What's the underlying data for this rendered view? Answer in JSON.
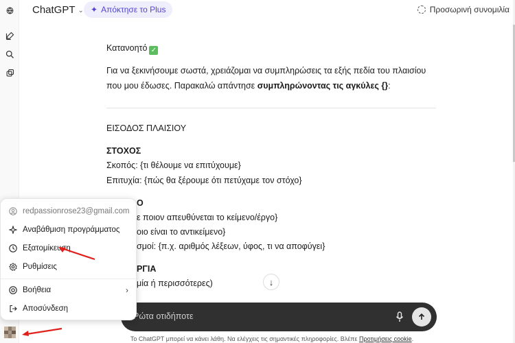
{
  "header": {
    "app_title": "ChatGPT",
    "plus_button": "Απόκτησε το Plus",
    "temp_chat": "Προσωρινή συνομιλία"
  },
  "content": {
    "understood": "Κατανοητό",
    "intro_line1": "Για να ξεκινήσουμε σωστά, χρειάζομαι να συμπληρώσεις τα εξής πεδία του πλαισίου",
    "intro_line2_pre": "που μου έδωσες. Παρακαλώ απάντησε ",
    "intro_line2_bold": "συμπληρώνοντας τις αγκύλες {}",
    "intro_line2_post": ":",
    "section_title": "ΕΙΣΟΔΟΣ ΠΛΑΙΣΙΟΥ",
    "goal_heading": "ΣΤΟΧΟΣ",
    "goal_purpose": "Σκοπός: {τι θέλουμε να επιτύχουμε}",
    "goal_success": "Επιτυχία: {πώς θα ξέρουμε ότι πετύχαμε τον στόχο}",
    "partial_heading": "Ο",
    "partial_1": "ε ποιον απευθύνεται το κείμενο/έργο}",
    "partial_2": "οιο είναι το αντικείμενο}",
    "partial_3": "σμοί: {π.χ. αριθμός λέξεων, ύφος, τι να αποφύγει}",
    "partial_heading2": "ΡΓΙΑ",
    "partial_4": "μία ή περισσότερες)"
  },
  "composer": {
    "placeholder": "Ρώτα οτιδήποτε"
  },
  "footer": {
    "note": "Το ChatGPT μπορεί να κάνει λάθη. Να ελέγχεις τις σημαντικές πληροφορίες. Βλέπε ",
    "link": "Προτιμήσεις cookie",
    "end": "."
  },
  "menu": {
    "email": "redpassionrose23@gmail.com",
    "upgrade": "Αναβάθμιση προγράμματος",
    "customize": "Εξατομίκευση",
    "settings": "Ρυθμίσεις",
    "help": "Βοήθεια",
    "logout": "Αποσύνδεση"
  },
  "colors": {
    "accent_purple": "#5145cd",
    "annotation_red": "#e0201b",
    "composer_bg": "#303030"
  },
  "icons": [
    "openai-logo-icon",
    "new-chat-icon",
    "search-icon",
    "library-icon",
    "user-circle-icon",
    "sparkle-icon",
    "customize-icon",
    "gear-icon",
    "help-icon",
    "logout-icon",
    "mic-icon",
    "send-icon",
    "arrow-down-icon"
  ]
}
